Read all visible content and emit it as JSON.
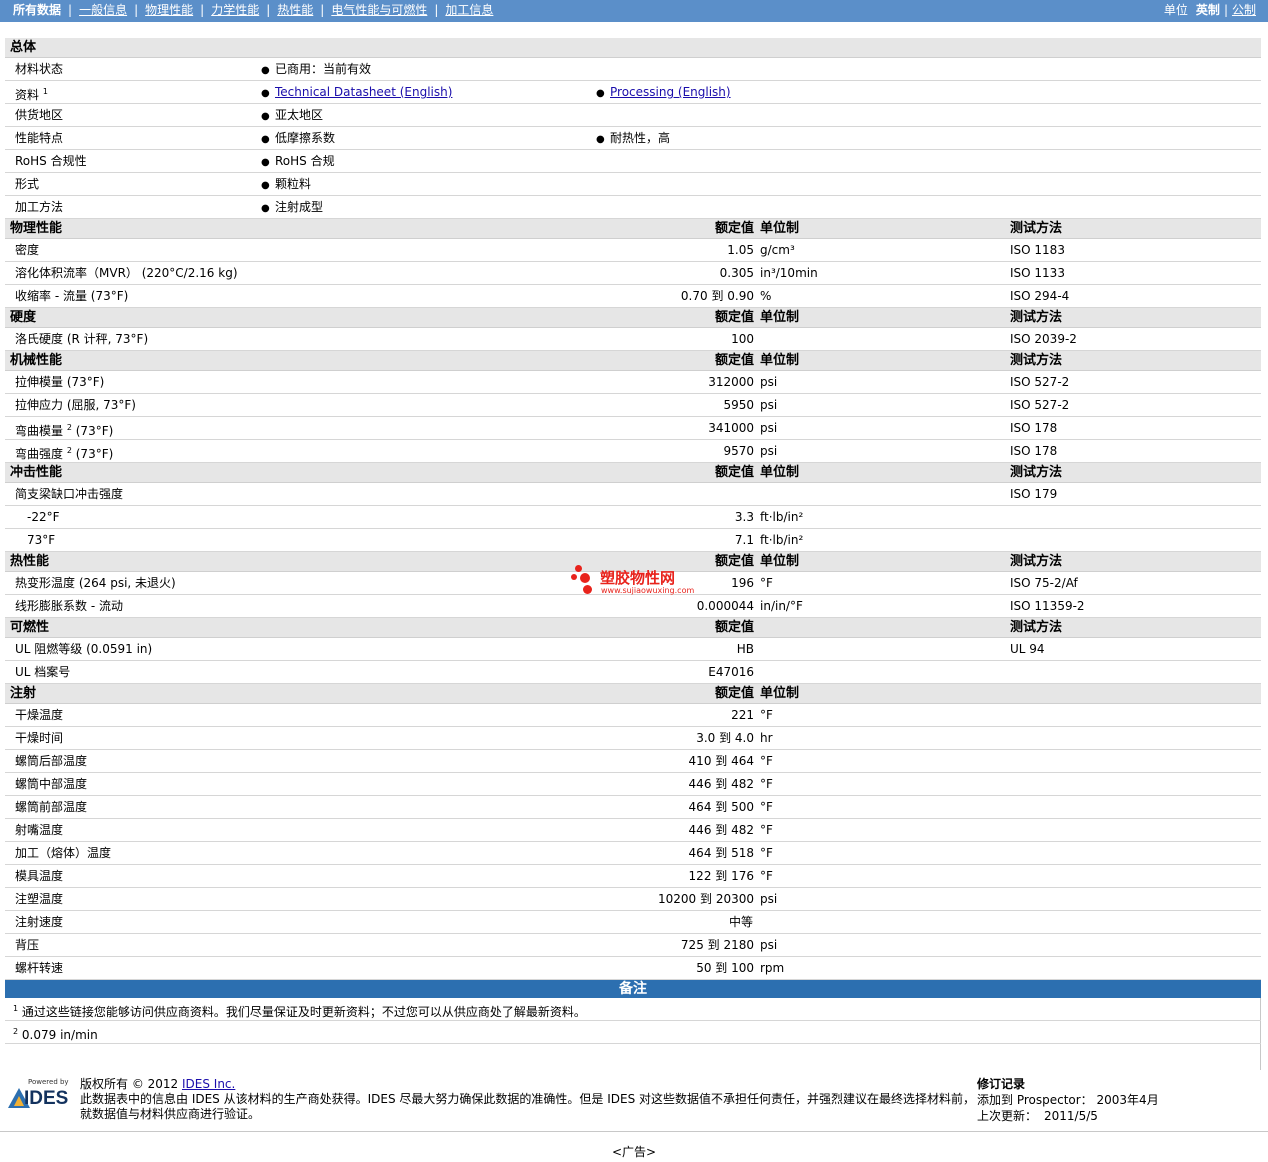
{
  "nav": {
    "tabs": [
      "所有数据",
      "一般信息",
      "物理性能",
      "力学性能",
      "热性能",
      "电气性能与可燃性",
      "加工信息"
    ],
    "units_label": "单位",
    "unit_imperial": "英制",
    "unit_metric": "公制"
  },
  "columns": {
    "value": "额定值",
    "unit": "单位制",
    "test": "测试方法"
  },
  "general": {
    "title": "总体",
    "rows": [
      {
        "name": "材料状态",
        "items": [
          "已商用：当前有效"
        ]
      },
      {
        "name": "资料",
        "sup": "1",
        "links": [
          "Technical Datasheet (English)",
          "Processing (English)"
        ]
      },
      {
        "name": "供货地区",
        "items": [
          "亚太地区"
        ]
      },
      {
        "name": "性能特点",
        "items": [
          "低摩擦系数",
          "耐热性，高"
        ]
      },
      {
        "name": "RoHS 合规性",
        "items": [
          "RoHS 合规"
        ]
      },
      {
        "name": "形式",
        "items": [
          "颗粒料"
        ]
      },
      {
        "name": "加工方法",
        "items": [
          "注射成型"
        ]
      }
    ]
  },
  "physical": {
    "title": "物理性能",
    "rows": [
      {
        "name": "密度",
        "value": "1.05",
        "unit": "g/cm³",
        "test": "ISO 1183"
      },
      {
        "name": "溶化体积流率（MVR） (220°C/2.16 kg)",
        "value": "0.305",
        "unit": "in³/10min",
        "test": "ISO 1133"
      },
      {
        "name": "收缩率 - 流量 (73°F)",
        "value": "0.70 到  0.90",
        "unit": "%",
        "test": "ISO 294-4"
      }
    ]
  },
  "hardness": {
    "title": "硬度",
    "rows": [
      {
        "name": "洛氏硬度 (R 计秤, 73°F)",
        "value": "100",
        "unit": "",
        "test": "ISO 2039-2"
      }
    ]
  },
  "mechanical": {
    "title": "机械性能",
    "rows": [
      {
        "name": "拉伸模量 (73°F)",
        "value": "312000",
        "unit": "psi",
        "test": "ISO 527-2"
      },
      {
        "name": "拉伸应力 (屈服, 73°F)",
        "value": "5950",
        "unit": "psi",
        "test": "ISO 527-2"
      },
      {
        "name": "弯曲模量",
        "sup": "2",
        "name_tail": " (73°F)",
        "value": "341000",
        "unit": "psi",
        "test": "ISO 178"
      },
      {
        "name": "弯曲强度",
        "sup": "2",
        "name_tail": " (73°F)",
        "value": "9570",
        "unit": "psi",
        "test": "ISO 178"
      }
    ]
  },
  "impact": {
    "title": "冲击性能",
    "parent": {
      "name": "简支梁缺口冲击强度",
      "test": "ISO 179"
    },
    "rows": [
      {
        "name": "-22°F",
        "value": "3.3",
        "unit": "ft·lb/in²"
      },
      {
        "name": "73°F",
        "value": "7.1",
        "unit": "ft·lb/in²"
      }
    ]
  },
  "thermal": {
    "title": "热性能",
    "rows": [
      {
        "name": "热变形温度 (264 psi, 未退火)",
        "value": "196",
        "unit": "°F",
        "test": "ISO 75-2/Af"
      },
      {
        "name": "线形膨胀系数 - 流动",
        "value": "0.000044",
        "unit": "in/in/°F",
        "test": "ISO 11359-2"
      }
    ]
  },
  "flammability": {
    "title": "可燃性",
    "rows": [
      {
        "name": "UL 阻燃等级 (0.0591 in)",
        "value": "HB",
        "unit": "",
        "test": "UL 94"
      },
      {
        "name": "UL 档案号",
        "value": "E47016",
        "unit": "",
        "test": ""
      }
    ]
  },
  "injection": {
    "title": "注射",
    "rows": [
      {
        "name": "干燥温度",
        "value": "221",
        "unit": "°F"
      },
      {
        "name": "干燥时间",
        "value": "3.0 到  4.0",
        "unit": "hr"
      },
      {
        "name": "螺筒后部温度",
        "value": "410 到  464",
        "unit": "°F"
      },
      {
        "name": "螺筒中部温度",
        "value": "446 到  482",
        "unit": "°F"
      },
      {
        "name": "螺筒前部温度",
        "value": "464 到  500",
        "unit": "°F"
      },
      {
        "name": "射嘴温度",
        "value": "446 到  482",
        "unit": "°F"
      },
      {
        "name": "加工（熔体）温度",
        "value": "464 到  518",
        "unit": "°F"
      },
      {
        "name": "模具温度",
        "value": "122 到  176",
        "unit": "°F"
      },
      {
        "name": "注塑温度",
        "value": "10200 到  20300",
        "unit": "psi"
      },
      {
        "name": "注射速度",
        "value": "中等",
        "unit": "",
        "center": true
      },
      {
        "name": "背压",
        "value": "725 到  2180",
        "unit": "psi"
      },
      {
        "name": "螺杆转速",
        "value": "50 到  100",
        "unit": "rpm"
      }
    ]
  },
  "notes": {
    "title": "备注",
    "items": [
      {
        "sup": "1",
        "text": "通过这些链接您能够访问供应商资料。我们尽量保证及时更新资料；不过您可以从供应商处了解最新资料。"
      },
      {
        "sup": "2",
        "text": "0.079 in/min"
      }
    ]
  },
  "footer": {
    "powered_by": "Powered by",
    "logo_text": "IDES",
    "copyright_prefix": "版权所有 © 2012 ",
    "copyright_link": "IDES Inc.",
    "disclaimer_1": "此数据表中的信息由 IDES 从该材料的生产商处获得。IDES 尽最大努力确保此数据的准确性。但是 IDES 对这些数据值不承担任何责任，并强烈建议在最终选择材料前，",
    "disclaimer_2": "就数据值与材料供应商进行验证。",
    "revision_title": "修订记录",
    "added_label": "添加到 Prospector：",
    "added_value": "2003年4月",
    "updated_label": "上次更新：",
    "updated_value": "2011/5/5"
  },
  "watermark": {
    "title": "塑胶物性网",
    "url": "www.sujiaowuxing.com"
  },
  "ad": "<广告>",
  "colors": {
    "topbar": "#5b8fc9",
    "section_header": "#e6e6e6",
    "notes_bar": "#2c6fb0",
    "link": "#1a0dab",
    "watermark": "#e8231c"
  }
}
